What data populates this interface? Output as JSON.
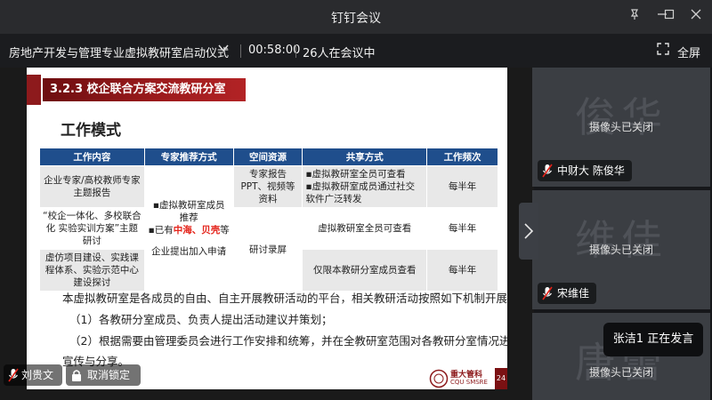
{
  "window": {
    "title": "钉钉会议"
  },
  "meeting": {
    "name": "房地产开发与管理专业虚拟教研室启动仪式",
    "timer": "00:58:00",
    "participants": "26人在会议中",
    "fullscreen_label": "全屏"
  },
  "slide": {
    "section": "3.2.3 校企联合方案交流教研分室",
    "subtitle": "工作模式",
    "table": {
      "headers": [
        "工作内容",
        "专家推荐方式",
        "空间资源",
        "共享方式",
        "工作频次"
      ],
      "r1": {
        "content": "企业专家/高校教师专家主题报告",
        "method": "▪虚拟教研室成员",
        "space": "专家报告PPT、视频等资料",
        "share_1": "▪虚拟教研室全员可查看",
        "share_2": "▪虚拟教研室成员通过社交软件广泛转发",
        "freq": "每半年"
      },
      "r2": {
        "content": "“校企一体化、多校联合化 实验实训方案”主题研讨",
        "method_1": "推荐",
        "method_2a": "▪已有",
        "method_2b": "中海、贝壳",
        "method_2c": "等",
        "method_3": "企业提出加入申请",
        "space": "研讨录屏",
        "share": "虚拟教研室全员可查看",
        "freq": "每半年"
      },
      "r3": {
        "content": "虚仿项目建设、实践课程体系、实验示范中心建设探讨",
        "share": "仅限本教研分室成员查看",
        "freq": "每半年"
      }
    },
    "para_1": "本虚拟教研室是各成员的自由、自主开展教研活动的平台，相关教研活动按照如下机制开展：",
    "para_2": "（1）各教研分室成员、负责人提出活动建议并策划；",
    "para_3": "（2）根据需要由管理委员会进行工作安排和统筹，并在全教研室范围对各教研分室情况进行",
    "para_4": "宣传与分享。",
    "logo_text_1": "重大管科",
    "logo_text_2": "CQU SMSRE",
    "page_number": "24"
  },
  "participants_panel": [
    {
      "watermark": "俊华",
      "status": "摄像头已关闭",
      "name": "中财大 陈俊华"
    },
    {
      "watermark": "维佳",
      "status": "摄像头已关闭",
      "name": "宋维佳"
    },
    {
      "watermark": "唐蕾",
      "status": "摄像头已关闭",
      "name": ""
    }
  ],
  "speaking": "张洁1  正在发言",
  "bottom_bar": {
    "speaker_name": "刘贵文",
    "lock_label": "取消锁定"
  },
  "colors": {
    "accent_red": "#9e1b1d",
    "table_header": "#1f4e8c"
  }
}
